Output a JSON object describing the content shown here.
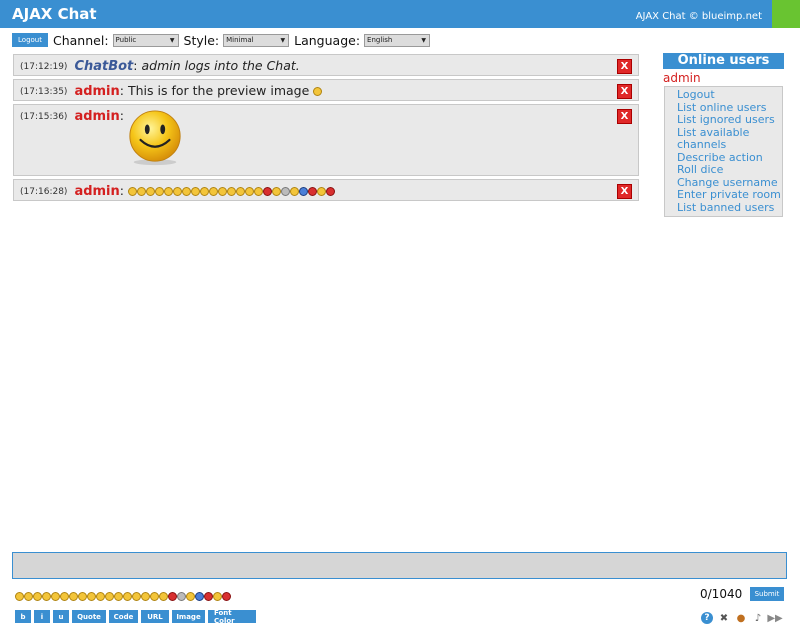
{
  "header": {
    "title": "AJAX Chat",
    "copyright": "AJAX Chat © blueimp.net"
  },
  "toolbar": {
    "logout_label": "Logout",
    "channel_label": "Channel:",
    "channel_value": "Public",
    "style_label": "Style:",
    "style_value": "Minimal",
    "language_label": "Language:",
    "language_value": "English"
  },
  "messages": [
    {
      "time": "(17:12:19)",
      "user": "ChatBot",
      "sep": ":",
      "text": "admin logs into the Chat."
    },
    {
      "time": "(17:13:35)",
      "user": "admin",
      "sep": ":",
      "text": "This is for the preview image"
    },
    {
      "time": "(17:15:36)",
      "user": "admin",
      "sep": ":",
      "text": ""
    },
    {
      "time": "(17:16:28)",
      "user": "admin",
      "sep": ":",
      "text": ""
    }
  ],
  "delete_label": "X",
  "online": {
    "title": "Online users",
    "user": "admin",
    "menu": [
      "Logout",
      "List online users",
      "List ignored users",
      "List available channels",
      "Describe action",
      "Roll dice",
      "Change username",
      "Enter private room",
      "List banned users"
    ]
  },
  "input": {
    "counter": "0/1040",
    "submit_label": "Submit"
  },
  "format_buttons": [
    "b",
    "i",
    "u",
    "Quote",
    "Code",
    "URL",
    "Image",
    "Font Color"
  ],
  "bottom_icons": [
    "help-icon",
    "settings-icon",
    "users-icon",
    "sound-icon",
    "autoscroll-icon"
  ],
  "colors": {
    "accent": "#3a8fd1",
    "user": "#d42020",
    "bot": "#3b5998",
    "green": "#69c431"
  }
}
